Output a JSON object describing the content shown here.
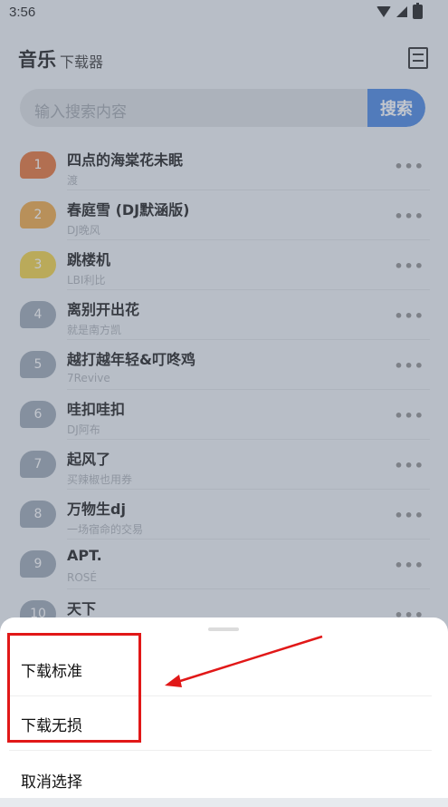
{
  "status_bar": {
    "time": "3:56",
    "icons": [
      "wifi-icon",
      "signal-icon",
      "battery-icon"
    ]
  },
  "header": {
    "title": "音乐",
    "subtitle": "下载器",
    "swap_icon": "swap-icon"
  },
  "search": {
    "placeholder": "输入搜索内容",
    "button_label": "搜索",
    "accent": "#3d7fe0"
  },
  "songs": [
    {
      "rank": "1",
      "title": "四点的海棠花未眠",
      "artist": "渡",
      "color": "#e46a2a"
    },
    {
      "rank": "2",
      "title": "春庭雪 (DJ默涵版)",
      "artist": "DJ晚风",
      "color": "#eea33a"
    },
    {
      "rank": "3",
      "title": "跳楼机",
      "artist": "LBI利比",
      "color": "#f2cf3a"
    },
    {
      "rank": "4",
      "title": "离别开出花",
      "artist": "就是南方凯",
      "color": "#97a2b0"
    },
    {
      "rank": "5",
      "title": "越打越年轻&叮咚鸡",
      "artist": "7Revive",
      "color": "#97a2b0"
    },
    {
      "rank": "6",
      "title": "哇扣哇扣",
      "artist": "DJ阿布",
      "color": "#97a2b0"
    },
    {
      "rank": "7",
      "title": "起风了",
      "artist": "买辣椒也用券",
      "color": "#97a2b0"
    },
    {
      "rank": "8",
      "title": "万物生dj",
      "artist": "一场宿命的交易",
      "color": "#97a2b0"
    },
    {
      "rank": "9",
      "title": "APT.",
      "artist": "ROSÉ",
      "color": "#97a2b0"
    },
    {
      "rank": "10",
      "title": "天下",
      "artist": "",
      "color": "#97a2b0"
    }
  ],
  "more_label": "•••",
  "sheet": {
    "options": [
      "下载标准",
      "下载无损",
      "取消选择"
    ]
  },
  "annotation": {
    "color": "#e11818"
  }
}
